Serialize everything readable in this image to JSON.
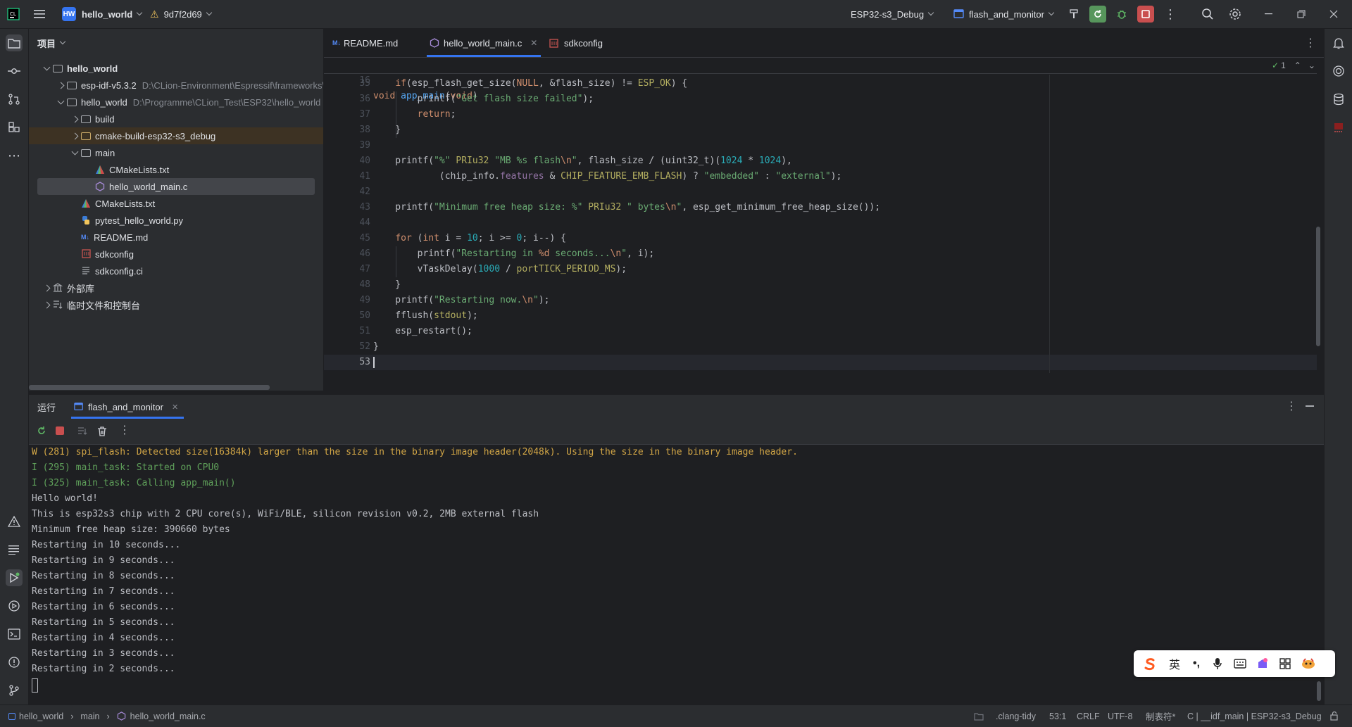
{
  "titlebar": {
    "project_badge": "HW",
    "project_name": "hello_world",
    "vcs_commit": "9d7f2d69",
    "run_config_profile": "ESP32-s3_Debug",
    "run_config_name": "flash_and_monitor"
  },
  "project_panel": {
    "title": "项目",
    "tree": [
      {
        "label": "hello_world",
        "path": "",
        "depth": 0,
        "expanded": true,
        "kind": "root-folder"
      },
      {
        "label": "esp-idf-v5.3.2",
        "path": "D:\\CLion-Environment\\Espressif\\frameworks\\",
        "depth": 1,
        "expanded": false,
        "kind": "folder"
      },
      {
        "label": "hello_world",
        "path": "D:\\Programme\\CLion_Test\\ESP32\\hello_world",
        "depth": 1,
        "expanded": true,
        "kind": "folder"
      },
      {
        "label": "build",
        "path": "",
        "depth": 2,
        "expanded": false,
        "kind": "folder"
      },
      {
        "label": "cmake-build-esp32-s3_debug",
        "path": "",
        "depth": 2,
        "expanded": false,
        "kind": "folder-excluded"
      },
      {
        "label": "main",
        "path": "",
        "depth": 2,
        "expanded": true,
        "kind": "folder"
      },
      {
        "label": "CMakeLists.txt",
        "path": "",
        "depth": 3,
        "kind": "cmake"
      },
      {
        "label": "hello_world_main.c",
        "path": "",
        "depth": 3,
        "kind": "c-file",
        "selected": true
      },
      {
        "label": "CMakeLists.txt",
        "path": "",
        "depth": 2,
        "kind": "cmake"
      },
      {
        "label": "pytest_hello_world.py",
        "path": "",
        "depth": 2,
        "kind": "python"
      },
      {
        "label": "README.md",
        "path": "",
        "depth": 2,
        "kind": "markdown"
      },
      {
        "label": "sdkconfig",
        "path": "",
        "depth": 2,
        "kind": "config"
      },
      {
        "label": "sdkconfig.ci",
        "path": "",
        "depth": 2,
        "kind": "text"
      },
      {
        "label": "外部库",
        "path": "",
        "depth": 0,
        "expanded": false,
        "kind": "library"
      },
      {
        "label": "临时文件和控制台",
        "path": "",
        "depth": 0,
        "expanded": false,
        "kind": "scratches"
      }
    ]
  },
  "editor": {
    "tabs": [
      {
        "label": "README.md",
        "icon": "markdown-icon",
        "active": false
      },
      {
        "label": "hello_world_main.c",
        "icon": "c-file-icon",
        "active": true
      },
      {
        "label": "sdkconfig",
        "icon": "config-icon",
        "active": false
      }
    ],
    "sticky_line": {
      "num": "16",
      "text": "void app_main(void)"
    },
    "inspection_count": "1",
    "lines": [
      {
        "num": "35",
        "html": "    <span class='kw'>if</span>(esp_flash_get_size(<span class='kw'>NULL</span>, &amp;flash_size) != <span class='mac'>ESP_OK</span>) {"
      },
      {
        "num": "36",
        "html": "        printf(<span class='str'>\"Get flash size failed\"</span>);"
      },
      {
        "num": "37",
        "html": "        <span class='kw'>return</span>;"
      },
      {
        "num": "38",
        "html": "    }"
      },
      {
        "num": "39",
        "html": ""
      },
      {
        "num": "40",
        "html": "    printf(<span class='str'>\"%\"</span> <span class='mac'>PRIu32</span> <span class='str'>\"MB %s flash<span class='esc'>\\n</span>\"</span>, flash_size / (uint32_t)(<span class='num'>1024</span> * <span class='num'>1024</span>),"
      },
      {
        "num": "41",
        "html": "            (chip_info.<span class='fld'>features</span> &amp; <span class='mac'>CHIP_FEATURE_EMB_FLASH</span>) ? <span class='str'>\"embedded\"</span> : <span class='str'>\"external\"</span>);"
      },
      {
        "num": "42",
        "html": ""
      },
      {
        "num": "43",
        "html": "    printf(<span class='str'>\"Minimum free heap size: %\"</span> <span class='mac'>PRIu32</span> <span class='str'>\" bytes<span class='esc'>\\n</span>\"</span>, esp_get_minimum_free_heap_size());"
      },
      {
        "num": "44",
        "html": ""
      },
      {
        "num": "45",
        "html": "    <span class='kw'>for</span> (<span class='kw'>int</span> i = <span class='num'>10</span>; i &gt;= <span class='num'>0</span>; i--) {"
      },
      {
        "num": "46",
        "html": "        printf(<span class='str'>\"Restarting in <span class='esc'>%d</span> seconds...<span class='esc'>\\n</span>\"</span>, i);"
      },
      {
        "num": "47",
        "html": "        vTaskDelay(<span class='num'>1000</span> / <span class='mac'>portTICK_PERIOD_MS</span>);"
      },
      {
        "num": "48",
        "html": "    }"
      },
      {
        "num": "49",
        "html": "    printf(<span class='str'>\"Restarting now.<span class='esc'>\\n</span>\"</span>);"
      },
      {
        "num": "50",
        "html": "    fflush(<span class='mac'>stdout</span>);"
      },
      {
        "num": "51",
        "html": "    esp_restart();"
      },
      {
        "num": "52",
        "html": "}"
      },
      {
        "num": "53",
        "html": ""
      }
    ]
  },
  "run_panel": {
    "title": "运行",
    "tab_label": "flash_and_monitor",
    "console_lines": [
      {
        "text": "W (281) spi_flash: Detected size(16384k) larger than the size in the binary image header(2048k). Using the size in the binary image header.",
        "level": "warn"
      },
      {
        "text": "I (295) main_task: Started on CPU0",
        "level": "info"
      },
      {
        "text": "I (325) main_task: Calling app_main()",
        "level": "info"
      },
      {
        "text": "Hello world!",
        "level": "plain"
      },
      {
        "text": "This is esp32s3 chip with 2 CPU core(s), WiFi/BLE, silicon revision v0.2, 2MB external flash",
        "level": "plain"
      },
      {
        "text": "Minimum free heap size: 390660 bytes",
        "level": "plain"
      },
      {
        "text": "Restarting in 10 seconds...",
        "level": "plain"
      },
      {
        "text": "Restarting in 9 seconds...",
        "level": "plain"
      },
      {
        "text": "Restarting in 8 seconds...",
        "level": "plain"
      },
      {
        "text": "Restarting in 7 seconds...",
        "level": "plain"
      },
      {
        "text": "Restarting in 6 seconds...",
        "level": "plain"
      },
      {
        "text": "Restarting in 5 seconds...",
        "level": "plain"
      },
      {
        "text": "Restarting in 4 seconds...",
        "level": "plain"
      },
      {
        "text": "Restarting in 3 seconds...",
        "level": "plain"
      },
      {
        "text": "Restarting in 2 seconds...",
        "level": "plain"
      }
    ]
  },
  "statusbar": {
    "breadcrumb": [
      "hello_world",
      "main",
      "hello_world_main.c"
    ],
    "linter": ".clang-tidy",
    "cursor": "53:1",
    "line_ending": "CRLF",
    "encoding": "UTF-8",
    "indent": "制表符*",
    "context": "C | __idf_main | ESP32-s3_Debug"
  },
  "ime": {
    "lang": "英",
    "punct": "•,"
  },
  "colors": {
    "warn": "#d2a646",
    "info": "#5fa05a",
    "accent": "#3574f0"
  }
}
